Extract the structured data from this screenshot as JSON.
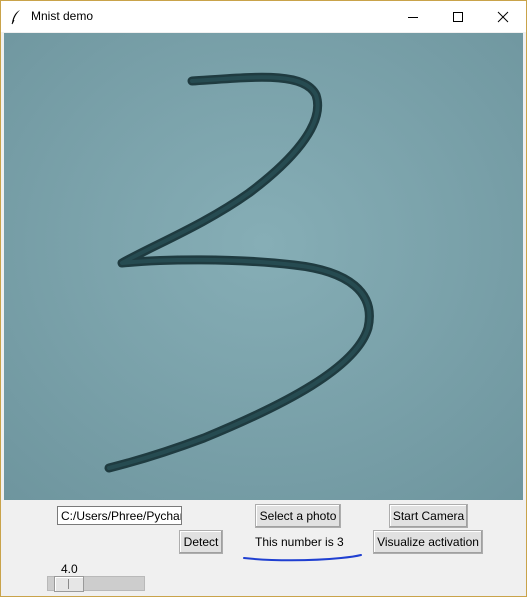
{
  "window": {
    "title": "Mnist demo",
    "icon": "feather-icon",
    "controls": [
      "minimize-icon",
      "maximize-icon",
      "close-icon"
    ]
  },
  "photo": {
    "description_icon": "handwritten-digit-image"
  },
  "controls": {
    "path_entry_value": "C:/Users/Phree/Pychar",
    "select_photo_label": "Select a photo",
    "start_camera_label": "Start Camera",
    "detect_label": "Detect",
    "result_text": "This number is 3",
    "visualize_label": "Visualize activation"
  },
  "scale": {
    "value_text": "4.0",
    "level": 4.0
  },
  "colors": {
    "title_border": "#c9a34a",
    "underline": "#1f3fd1",
    "ink": "#1e3a3e"
  }
}
